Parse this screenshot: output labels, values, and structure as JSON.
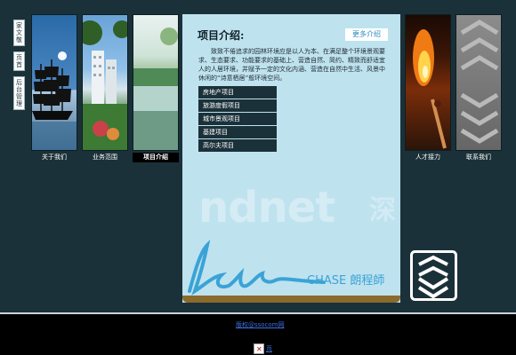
{
  "vnav": [
    {
      "label": "家文敬"
    },
    {
      "label": "页首"
    },
    {
      "label": "后台管理"
    }
  ],
  "columns": [
    {
      "label": "关于我们"
    },
    {
      "label": "业务范围"
    },
    {
      "label": "项目介绍"
    },
    {
      "label": "人才接力"
    },
    {
      "label": "联系我们"
    }
  ],
  "panel": {
    "title": "项目介绍:",
    "more": "更多介绍",
    "description": "致致不倦追求的园林环境应是以人为本、在满足整个环境景观要求、生态要求、功能要求的基础上、营造自然、简约、精致而舒适宜人的人居环境，并赋予一定的文化内涵、营造在自然中生活、风景中休闲的“诗意栖居”般环境空间。",
    "projects": [
      "房地产项目",
      "旅游度假项目",
      "城市景观项目",
      "基建项目",
      "高尔夫项目"
    ],
    "watermark": "ndnet",
    "watermark_cn": "深",
    "signature": "long",
    "brand": "CHASE 朗程師"
  },
  "footer": {
    "link": "版权@ssocom网",
    "broken_link": "页"
  },
  "colors": {
    "background": "#1b3139",
    "panel": "#bfe2ef",
    "accent": "#3aa3d6"
  }
}
